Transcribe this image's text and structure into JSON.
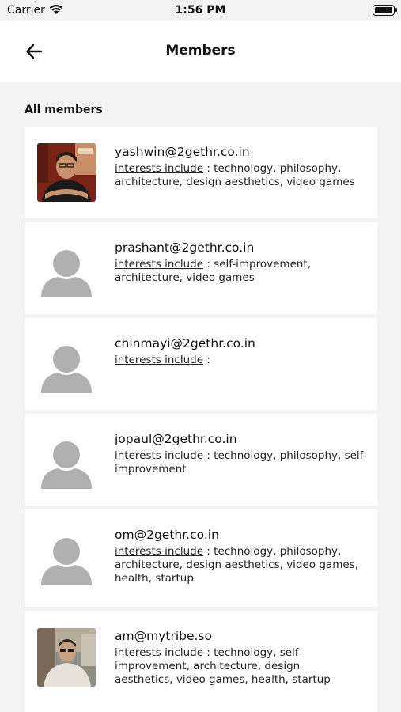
{
  "status_bar": {
    "carrier": "Carrier",
    "time": "1:56 PM"
  },
  "header": {
    "title": "Members",
    "back_icon": "arrow-left-icon"
  },
  "section": {
    "title": "All members"
  },
  "interests_label": "interests include",
  "members": [
    {
      "email": "yashwin@2gethr.co.in",
      "interests": " : technology, philosophy, architecture, design aesthetics, video games",
      "avatar": "photo"
    },
    {
      "email": "prashant@2gethr.co.in",
      "interests": " : self-improvement, architecture, video games",
      "avatar": "placeholder"
    },
    {
      "email": "chinmayi@2gethr.co.in",
      "interests": " :",
      "avatar": "placeholder"
    },
    {
      "email": "jopaul@2gethr.co.in",
      "interests": " : technology, philosophy, self-improvement",
      "avatar": "placeholder"
    },
    {
      "email": "om@2gethr.co.in",
      "interests": " : technology, philosophy, architecture, design aesthetics, video games, health, startup",
      "avatar": "placeholder"
    },
    {
      "email": "am@mytribe.so",
      "interests": " : technology, self-improvement, architecture, design aesthetics, video games, health, startup",
      "avatar": "photo"
    }
  ]
}
